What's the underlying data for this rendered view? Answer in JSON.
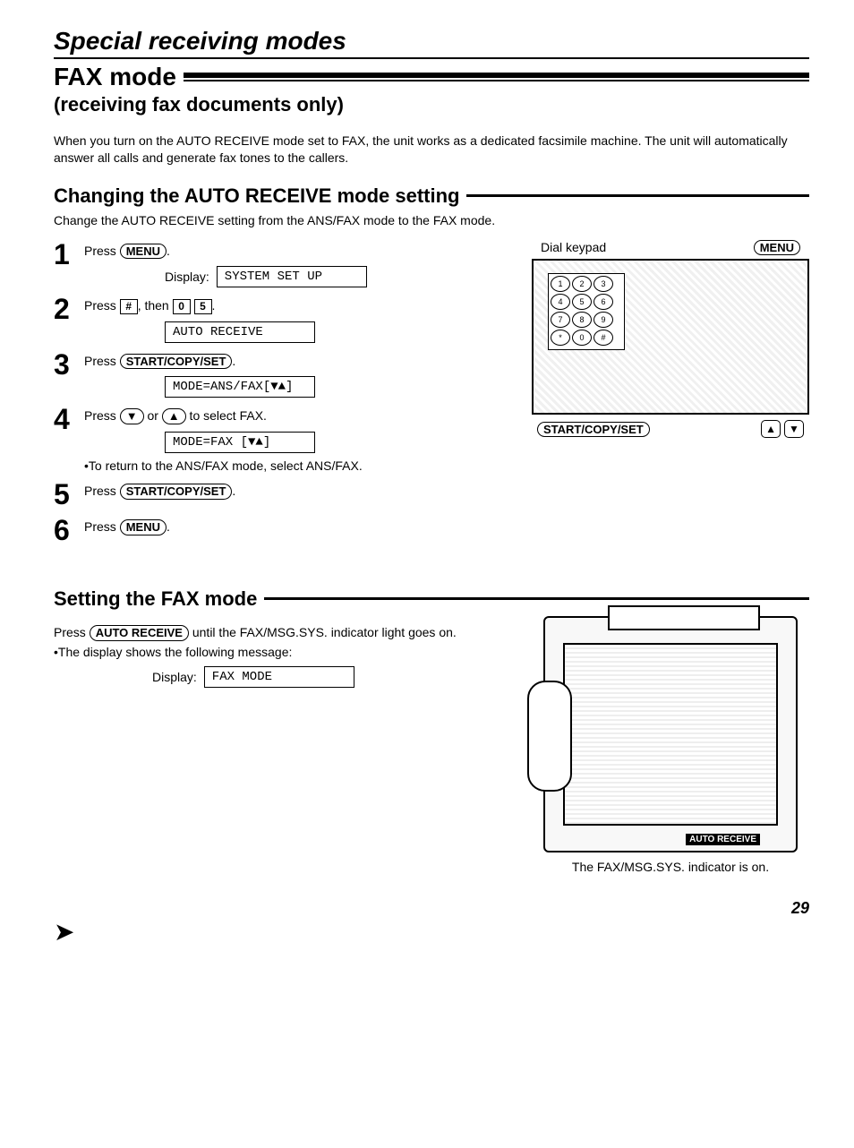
{
  "title": "Special receiving modes",
  "mode_title": "FAX mode",
  "mode_subtitle": "(receiving fax documents only)",
  "intro_para": "When you turn on the AUTO RECEIVE mode set to FAX, the unit works as a dedicated facsimile machine. The unit will automatically answer all calls and generate fax tones to the callers.",
  "section_change": {
    "heading": "Changing the AUTO RECEIVE mode setting",
    "intro": "Change the AUTO RECEIVE setting from the ANS/FAX mode to the FAX mode.",
    "display_label": "Display:",
    "steps": [
      {
        "num": "1",
        "prefix": "Press ",
        "keys": [
          "MENU"
        ],
        "suffix": ".",
        "display": "SYSTEM SET UP"
      },
      {
        "num": "2",
        "prefix": "Press ",
        "keys_inline": "#, then 0 5",
        "suffix": ".",
        "display": "AUTO RECEIVE"
      },
      {
        "num": "3",
        "prefix": "Press ",
        "keys": [
          "START/COPY/SET"
        ],
        "suffix": ".",
        "display": "MODE=ANS/FAX[▼▲]"
      },
      {
        "num": "4",
        "prefix": "Press ",
        "mid": "▼ or ▲",
        "suffix": " to select FAX.",
        "display": "MODE=FAX    [▼▲]",
        "note": "•To return to the ANS/FAX mode, select ANS/FAX."
      },
      {
        "num": "5",
        "prefix": "Press ",
        "keys": [
          "START/COPY/SET"
        ],
        "suffix": "."
      },
      {
        "num": "6",
        "prefix": "Press ",
        "keys": [
          "MENU"
        ],
        "suffix": "."
      }
    ],
    "figure": {
      "label_left": "Dial keypad",
      "label_right": "MENU",
      "footer_key": "START/COPY/SET",
      "arrow_up": "▲",
      "arrow_down": "▼",
      "keypad": [
        [
          "1",
          "2",
          "3"
        ],
        [
          "4",
          "5",
          "6"
        ],
        [
          "7",
          "8",
          "9"
        ],
        [
          "*",
          "0",
          "#"
        ]
      ]
    }
  },
  "section_set": {
    "heading": "Setting the FAX mode",
    "line1_prefix": "Press ",
    "line1_key": "AUTO RECEIVE",
    "line1_suffix": " until the FAX/MSG.SYS. indicator light goes on.",
    "line2": "•The display shows the following message:",
    "display_label": "Display:",
    "display": "FAX MODE",
    "auto_receive_label": "AUTO RECEIVE",
    "indicator_caption": "The FAX/MSG.SYS. indicator is on."
  },
  "page_number": "29"
}
